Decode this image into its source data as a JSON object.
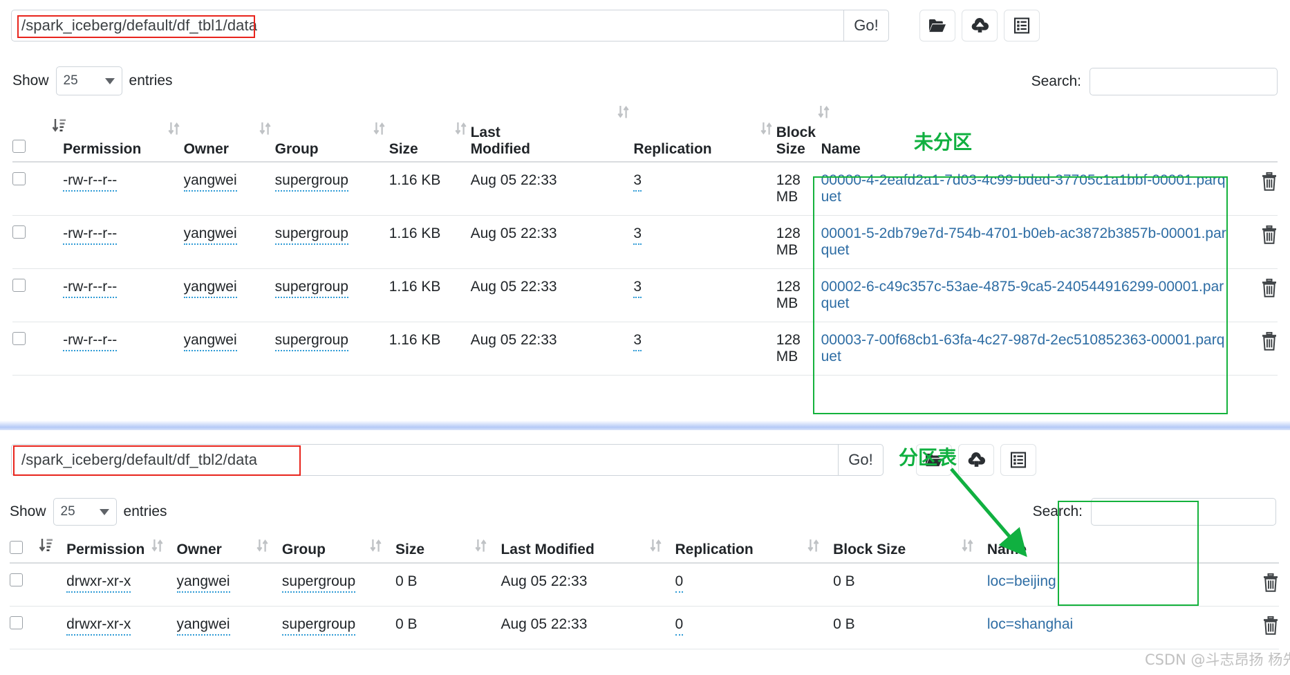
{
  "panels": [
    {
      "id": "top",
      "path_value": "/spark_iceberg/default/df_tbl1/data",
      "go_label": "Go!",
      "buttons": [
        {
          "name": "browse-folder-button",
          "icon": "folder-open-icon"
        },
        {
          "name": "upload-button",
          "icon": "cloud-upload-icon"
        },
        {
          "name": "file-list-button",
          "icon": "list-view-icon"
        }
      ],
      "show_label": "Show",
      "entries_value": "25",
      "entries_label": "entries",
      "search_label": "Search:",
      "search_value": "",
      "annotation": "未分区",
      "columns": [
        "Permission",
        "Owner",
        "Group",
        "Size",
        "Last Modified",
        "Replication",
        "Block Size",
        "Name"
      ],
      "rows": [
        {
          "permission": "-rw-r--r--",
          "owner": "yangwei",
          "group": "supergroup",
          "size": "1.16 KB",
          "modified": "Aug 05 22:33",
          "replication": "3",
          "block_size": "128 MB",
          "name": "00000-4-2eafd2a1-7d03-4c99-bded-37705c1a1bbf-00001.parquet"
        },
        {
          "permission": "-rw-r--r--",
          "owner": "yangwei",
          "group": "supergroup",
          "size": "1.16 KB",
          "modified": "Aug 05 22:33",
          "replication": "3",
          "block_size": "128 MB",
          "name": "00001-5-2db79e7d-754b-4701-b0eb-ac3872b3857b-00001.parquet"
        },
        {
          "permission": "-rw-r--r--",
          "owner": "yangwei",
          "group": "supergroup",
          "size": "1.16 KB",
          "modified": "Aug 05 22:33",
          "replication": "3",
          "block_size": "128 MB",
          "name": "00002-6-c49c357c-53ae-4875-9ca5-240544916299-00001.parquet"
        },
        {
          "permission": "-rw-r--r--",
          "owner": "yangwei",
          "group": "supergroup",
          "size": "1.16 KB",
          "modified": "Aug 05 22:33",
          "replication": "3",
          "block_size": "128 MB",
          "name": "00003-7-00f68cb1-63fa-4c27-987d-2ec510852363-00001.parquet"
        }
      ]
    },
    {
      "id": "bottom",
      "path_value": "/spark_iceberg/default/df_tbl2/data",
      "go_label": "Go!",
      "buttons": [
        {
          "name": "browse-folder-button",
          "icon": "folder-open-icon"
        },
        {
          "name": "upload-button",
          "icon": "cloud-upload-icon"
        },
        {
          "name": "file-list-button",
          "icon": "list-view-icon"
        }
      ],
      "show_label": "Show",
      "entries_value": "25",
      "entries_label": "entries",
      "search_label": "Search:",
      "search_value": "",
      "annotation": "分区表",
      "columns": [
        "Permission",
        "Owner",
        "Group",
        "Size",
        "Last Modified",
        "Replication",
        "Block Size",
        "Name"
      ],
      "rows": [
        {
          "permission": "drwxr-xr-x",
          "owner": "yangwei",
          "group": "supergroup",
          "size": "0 B",
          "modified": "Aug 05 22:33",
          "replication": "0",
          "block_size": "0 B",
          "name": "loc=beijing"
        },
        {
          "permission": "drwxr-xr-x",
          "owner": "yangwei",
          "group": "supergroup",
          "size": "0 B",
          "modified": "Aug 05 22:33",
          "replication": "0",
          "block_size": "0 B",
          "name": "loc=shanghai"
        }
      ]
    }
  ],
  "watermark": "CSDN @斗志昂扬 杨先生",
  "colors": {
    "annotation_green": "#10b040",
    "highlight_red": "#e8241c",
    "link_blue": "#2e6da4"
  }
}
